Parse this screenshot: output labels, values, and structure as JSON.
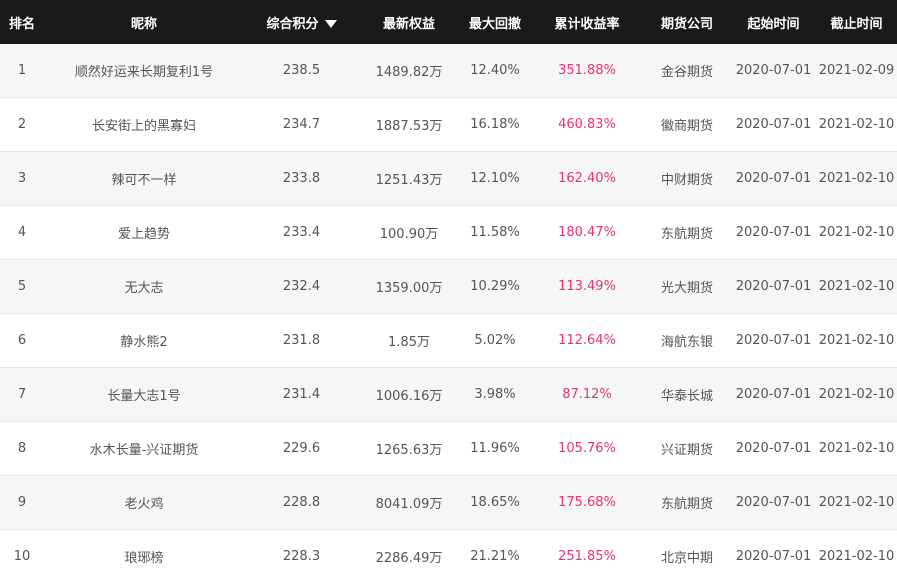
{
  "columns": [
    {
      "key": "rank",
      "label": "排名"
    },
    {
      "key": "nickname",
      "label": "昵称"
    },
    {
      "key": "score",
      "label": "综合积分"
    },
    {
      "key": "equity",
      "label": "最新权益"
    },
    {
      "key": "drawdown",
      "label": "最大回撤"
    },
    {
      "key": "return",
      "label": "累计收益率"
    },
    {
      "key": "company",
      "label": "期货公司"
    },
    {
      "key": "start",
      "label": "起始时间"
    },
    {
      "key": "end",
      "label": "截止时间"
    }
  ],
  "sort_column": "score",
  "sort_direction": "desc",
  "accent_color": "#e5327a",
  "header_bg": "#1a1a1a",
  "rows": [
    {
      "rank": "1",
      "nickname": "顺然好运来长期复利1号",
      "score": "238.5",
      "equity": "1489.82万",
      "drawdown": "12.40%",
      "return": "351.88%",
      "company": "金谷期货",
      "start": "2020-07-01",
      "end": "2021-02-09"
    },
    {
      "rank": "2",
      "nickname": "长安街上的黑寡妇",
      "score": "234.7",
      "equity": "1887.53万",
      "drawdown": "16.18%",
      "return": "460.83%",
      "company": "徽商期货",
      "start": "2020-07-01",
      "end": "2021-02-10"
    },
    {
      "rank": "3",
      "nickname": "辣可不一样",
      "score": "233.8",
      "equity": "1251.43万",
      "drawdown": "12.10%",
      "return": "162.40%",
      "company": "中财期货",
      "start": "2020-07-01",
      "end": "2021-02-10"
    },
    {
      "rank": "4",
      "nickname": "爱上趋势",
      "score": "233.4",
      "equity": "100.90万",
      "drawdown": "11.58%",
      "return": "180.47%",
      "company": "东航期货",
      "start": "2020-07-01",
      "end": "2021-02-10"
    },
    {
      "rank": "5",
      "nickname": "无大志",
      "score": "232.4",
      "equity": "1359.00万",
      "drawdown": "10.29%",
      "return": "113.49%",
      "company": "光大期货",
      "start": "2020-07-01",
      "end": "2021-02-10"
    },
    {
      "rank": "6",
      "nickname": "静水熊2",
      "score": "231.8",
      "equity": "1.85万",
      "drawdown": "5.02%",
      "return": "112.64%",
      "company": "海航东银",
      "start": "2020-07-01",
      "end": "2021-02-10"
    },
    {
      "rank": "7",
      "nickname": "长量大志1号",
      "score": "231.4",
      "equity": "1006.16万",
      "drawdown": "3.98%",
      "return": "87.12%",
      "company": "华泰长城",
      "start": "2020-07-01",
      "end": "2021-02-10"
    },
    {
      "rank": "8",
      "nickname": "水木长量-兴证期货",
      "score": "229.6",
      "equity": "1265.63万",
      "drawdown": "11.96%",
      "return": "105.76%",
      "company": "兴证期货",
      "start": "2020-07-01",
      "end": "2021-02-10"
    },
    {
      "rank": "9",
      "nickname": "老火鸡",
      "score": "228.8",
      "equity": "8041.09万",
      "drawdown": "18.65%",
      "return": "175.68%",
      "company": "东航期货",
      "start": "2020-07-01",
      "end": "2021-02-10"
    },
    {
      "rank": "10",
      "nickname": "琅琊榜",
      "score": "228.3",
      "equity": "2286.49万",
      "drawdown": "21.21%",
      "return": "251.85%",
      "company": "北京中期",
      "start": "2020-07-01",
      "end": "2021-02-10"
    }
  ]
}
